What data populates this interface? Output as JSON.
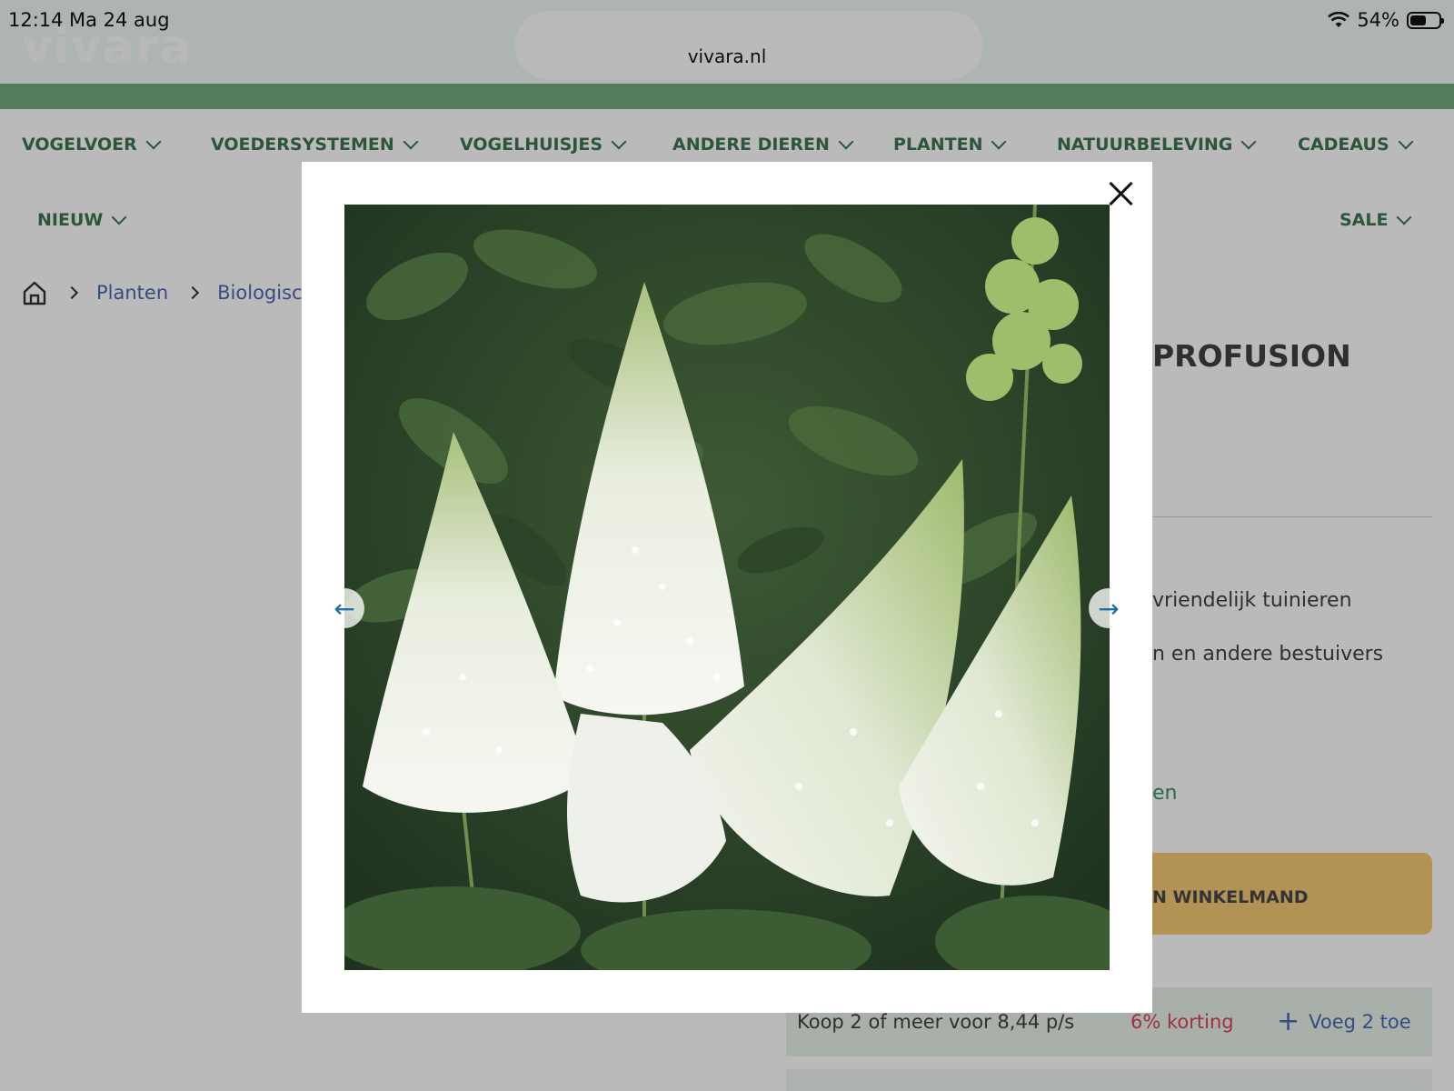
{
  "status_bar": {
    "time": "12:14",
    "date": "Ma 24 aug",
    "battery": "54%"
  },
  "browser": {
    "url": "vivara.nl"
  },
  "nav": {
    "items": [
      {
        "label": "VOGELVOER"
      },
      {
        "label": "VOEDERSYSTEMEN"
      },
      {
        "label": "VOGELHUISJES"
      },
      {
        "label": "ANDERE DIEREN"
      },
      {
        "label": "PLANTEN"
      },
      {
        "label": "NATUURBELEVING"
      },
      {
        "label": "CADEAUS"
      },
      {
        "label": "NIEUW"
      },
      {
        "label": "SALE"
      }
    ]
  },
  "breadcrumb": {
    "items": [
      "Planten",
      "Biologische"
    ]
  },
  "product": {
    "title_visible": "PROFUSION",
    "features": [
      "vriendelijk tuinieren",
      "n en andere bestuivers"
    ],
    "link_fragment": "en",
    "cart_button": "N WINKELMAND"
  },
  "promo": {
    "text": "Koop 2 of meer voor 8,44 p/s",
    "discount": "6% korting",
    "add_label": "Voeg 2 toe",
    "add_icon": "plus-icon"
  },
  "colors": {
    "nav_text": "#2f6b45",
    "green_strip": "#6aa37a",
    "cart_button": "#f4c56a",
    "discount": "#d8344a",
    "link": "#3d5dab"
  },
  "modal": {
    "close_icon": "close-icon",
    "prev_icon": "arrow-left-icon",
    "next_icon": "arrow-right-icon"
  }
}
